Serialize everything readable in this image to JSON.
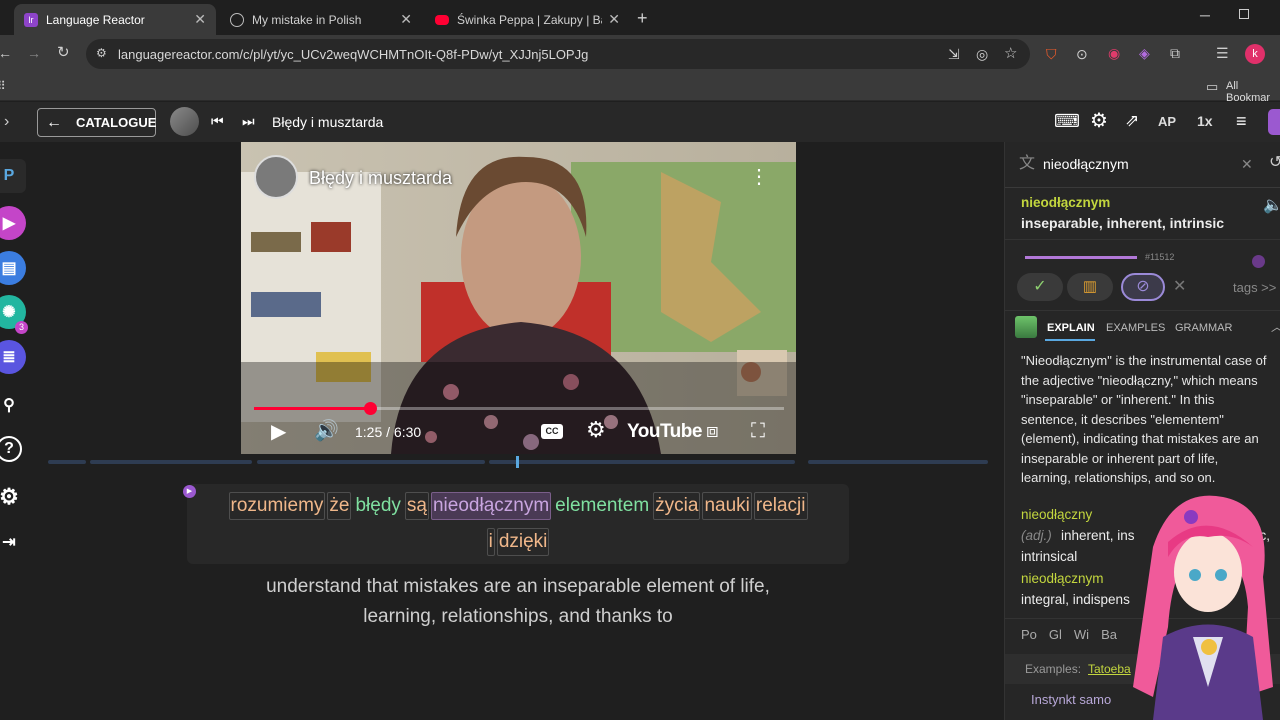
{
  "tabs": [
    {
      "title": "Language Reactor",
      "active": true
    },
    {
      "title": "My mistake in Polish",
      "active": false
    },
    {
      "title": "Świnka Peppa | Zakupy | Bajki P",
      "active": false
    }
  ],
  "address_bar": {
    "url": "languagereactor.com/c/pl/yt/yc_UCv2weqWCHMTnOIt-Q8f-PDw/yt_XJJnj5LOPJg"
  },
  "bookmarks": {
    "all_bookmarks": "All Bookmar"
  },
  "profile_initial": "k",
  "lr_header": {
    "catalogue_label": "CATALOGUE",
    "video_title": "Błędy i musztarda",
    "speed": "1x",
    "ap_label": "AP"
  },
  "left_nav": {
    "p_label": "P",
    "badge": "3"
  },
  "video": {
    "overlay_title": "Błędy i musztarda",
    "time": "1:25 / 6:30",
    "youtube_label": "YouTube",
    "progress": 0.218
  },
  "subtitle": {
    "words": [
      {
        "text": "rozumiemy",
        "style": "orange"
      },
      {
        "text": "że",
        "style": "orange"
      },
      {
        "text": "błędy",
        "style": "green"
      },
      {
        "text": "są",
        "style": "orange"
      },
      {
        "text": "nieodłącznym",
        "style": "purple"
      },
      {
        "text": "elementem",
        "style": "green"
      },
      {
        "text": "życia",
        "style": "orange"
      },
      {
        "text": "nauki",
        "style": "orange"
      },
      {
        "text": "relacji",
        "style": "orange"
      }
    ],
    "words_line2": [
      {
        "text": "i",
        "style": "orange"
      },
      {
        "text": "dzięki",
        "style": "orange"
      }
    ],
    "translation_line1": "understand that mistakes are an inseparable element of life,",
    "translation_line2": "learning, relationships, and thanks to"
  },
  "dictionary": {
    "search_value": "nieodłącznym",
    "headword": "nieodłącznym",
    "gloss": "inseparable, inherent, intrinsic",
    "rank": "#11512",
    "tags_label": "tags >>",
    "tabs": [
      "EXPLAIN",
      "EXAMPLES",
      "GRAMMAR"
    ],
    "explain_lines": [
      "\"Nieodłącznym\" is the instrumental case of",
      "the adjective \"nieodłączny,\" which means",
      "\"inseparable\" or \"inherent.\" In this",
      "sentence, it describes \"elementem\"",
      "(element), indicating that mistakes are an",
      "inseparable or inherent part of life,",
      "learning, relationships, and so on."
    ],
    "entry1_head": "nieodłączny",
    "entry1_pos": "(adj.)",
    "entry1_gloss": "inherent, ins",
    "entry1_gloss_tail": "trinsic,",
    "entry1_line2": "intrinsical",
    "entry2_head": "nieodłącznym",
    "entry2_gloss": "integral, indispens",
    "sources": [
      "Po",
      "Gl",
      "Wi",
      "Ba"
    ],
    "examples_label": "Examples:",
    "examples_source": "Tatoeba",
    "example_start": "Instynkt samo"
  },
  "colors": {
    "accent_purple": "#9b59d0",
    "youtube_red": "#ff0033",
    "lime": "#c3d63e"
  }
}
